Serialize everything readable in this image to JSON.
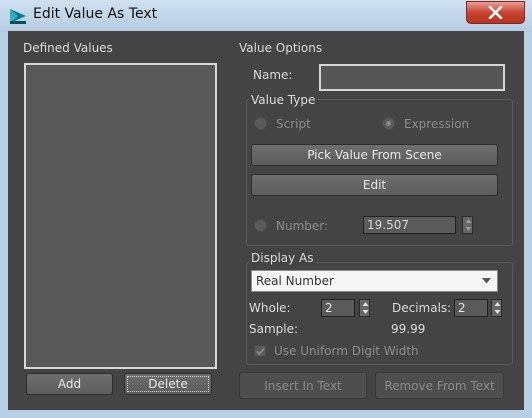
{
  "window": {
    "title": "Edit Value As Text"
  },
  "defined_values": {
    "label": "Defined Values",
    "add_label": "Add",
    "delete_label": "Delete"
  },
  "value_options": {
    "label": "Value Options",
    "name_label": "Name:",
    "name_value": "",
    "value_type": {
      "label": "Value Type",
      "script_label": "Script",
      "expression_label": "Expression",
      "pick_label": "Pick Value From Scene",
      "edit_label": "Edit",
      "number_label": "Number:",
      "number_value": "19.507"
    },
    "display_as": {
      "label": "Display As",
      "selected": "Real Number",
      "whole_label": "Whole:",
      "whole_value": "2",
      "decimals_label": "Decimals:",
      "decimals_value": "2",
      "sample_label": "Sample:",
      "sample_value": "99.99",
      "uniform_label": "Use Uniform Digit Width"
    },
    "insert_label": "Insert In Text",
    "remove_label": "Remove From Text"
  }
}
